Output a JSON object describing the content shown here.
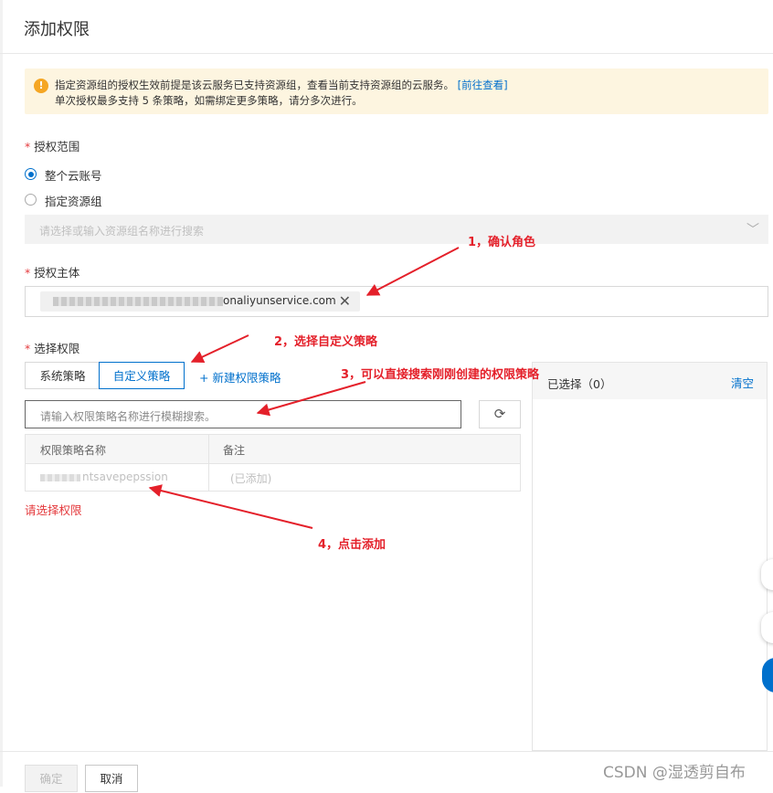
{
  "dialog": {
    "title": "添加权限"
  },
  "notice": {
    "line1_text": "指定资源组的授权生效前提是该云服务已支持资源组，查看当前支持资源组的云服务。",
    "line1_link": "[前往查看]",
    "line2": "单次授权最多支持 5 条策略，如需绑定更多策略，请分多次进行。"
  },
  "scope": {
    "label": "授权范围",
    "options": [
      {
        "label": "整个云账号",
        "selected": true
      },
      {
        "label": "指定资源组",
        "selected": false
      }
    ],
    "resource_group_placeholder": "请选择或输入资源组名称进行搜索"
  },
  "principal": {
    "label": "授权主体",
    "tag_text": "onaliyunservice.com",
    "remove_icon": "✕"
  },
  "permissions": {
    "label": "选择权限",
    "tabs": [
      "系统策略",
      "自定义策略"
    ],
    "active_tab": "自定义策略",
    "new_policy": "+ 新建权限策略",
    "search_placeholder": "请输入权限策略名称进行模糊搜索。",
    "table": {
      "headers": [
        "权限策略名称",
        "备注"
      ],
      "rows": [
        {
          "name": "ntsavepерssion",
          "note": "(已添加)"
        }
      ]
    },
    "error": "请选择权限"
  },
  "selected": {
    "title": "已选择（0）",
    "clear": "清空"
  },
  "footer": {
    "ok": "确定",
    "cancel": "取消"
  },
  "annotations": {
    "a1": "1，确认角色",
    "a2": "2，选择自定义策略",
    "a3": "3，可以直接搜索刚刚创建的权限策略",
    "a4": "4，点击添加"
  },
  "watermark": "CSDN @湿透剪自布",
  "colors": {
    "accent": "#0070cc",
    "annotation": "#e4202a",
    "warning_bg": "#fdf5e0",
    "error": "#e4393c"
  }
}
